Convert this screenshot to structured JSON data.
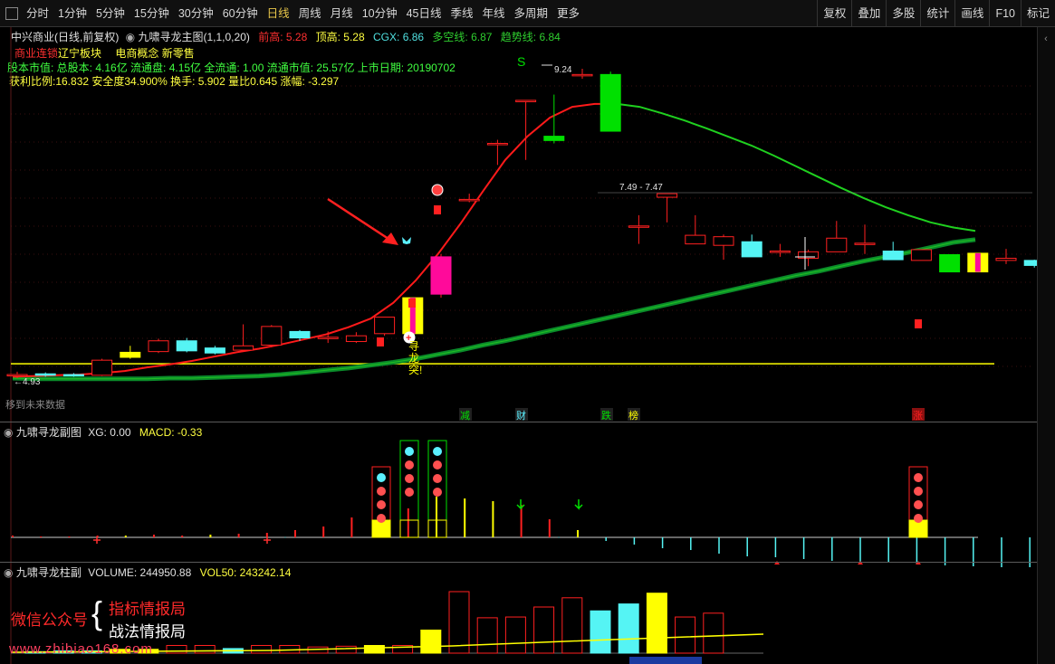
{
  "toolbar": {
    "periods": [
      "分时",
      "1分钟",
      "5分钟",
      "15分钟",
      "30分钟",
      "60分钟",
      "日线",
      "周线",
      "月线",
      "10分钟",
      "45日线",
      "季线",
      "年线",
      "多周期",
      "更多"
    ],
    "active_period": "日线",
    "right": [
      "复权",
      "叠加",
      "多股",
      "统计",
      "画线",
      "F10",
      "标记"
    ]
  },
  "main": {
    "stock": "中兴商业(日线,前复权)",
    "indicator": "九啸寻龙主图(1,1,0,20)",
    "qg_label": "前高:",
    "qg_val": "5.28",
    "dg_label": "顶高:",
    "dg_val": "5.28",
    "cgx_label": "CGX:",
    "cgx_val": "6.86",
    "dkx_label": "多空线:",
    "dkx_val": "6.87",
    "qsx_label": "趋势线:",
    "qsx_val": "6.84",
    "sector1": "商业连锁",
    "sector2": "辽宁板块",
    "concept": "电商概念 新零售",
    "fund_line": "股本市值: 总股本: 4.16亿 流通盘: 4.15亿 全流通: 1.00 流通市值: 25.57亿 上市日期: 20190702",
    "ratio_line": "获利比例:16.832   安全度34.900%      换手: 5.902   量比0.645    涨幅: -3.297",
    "price_high": "9.24",
    "price_range": "7.49 - 7.47",
    "price_low": "4.93",
    "future_label": "移到未来数据",
    "s_mark": "S",
    "signal_text": [
      "寻",
      "龙",
      "突!"
    ],
    "event_tags": [
      "减",
      "财",
      "跌",
      "榜",
      "涨"
    ]
  },
  "sub1": {
    "title": "九啸寻龙副图",
    "xg_label": "XG:",
    "xg_val": "0.00",
    "macd_label": "MACD:",
    "macd_val": "-0.33"
  },
  "sub2": {
    "title": "九啸寻龙柱副",
    "vol_label": "VOLUME:",
    "vol_val": "244950.88",
    "vol50_label": "VOL50:",
    "vol50_val": "243242.14"
  },
  "watermark": {
    "left": "微信公众号",
    "line1": "指标情报局",
    "line2": "战法情报局",
    "url": "www.zhibiao168.com"
  },
  "colors": {
    "up": "#ff2020",
    "down": "#55f4f4",
    "magenta": "#ff0a9a",
    "yellow": "#ffff00",
    "green": "#00e000",
    "ma_red": "#ff1a1a",
    "ma_green": "#1fd01f",
    "dark_green": "#0a8a2a"
  },
  "chart_data": {
    "type": "candlestick",
    "candles": [
      {
        "o": 4.98,
        "c": 4.98,
        "h": 5.02,
        "l": 4.93,
        "color": "up"
      },
      {
        "o": 4.99,
        "c": 4.97,
        "h": 5.01,
        "l": 4.95,
        "color": "down"
      },
      {
        "o": 4.98,
        "c": 4.97,
        "h": 5.0,
        "l": 4.95,
        "color": "down"
      },
      {
        "o": 4.97,
        "c": 5.18,
        "h": 5.2,
        "l": 4.96,
        "color": "up"
      },
      {
        "o": 5.22,
        "c": 5.29,
        "h": 5.38,
        "l": 5.2,
        "color": "yellow"
      },
      {
        "o": 5.3,
        "c": 5.45,
        "h": 5.48,
        "l": 5.28,
        "color": "up"
      },
      {
        "o": 5.45,
        "c": 5.31,
        "h": 5.49,
        "l": 5.29,
        "color": "down"
      },
      {
        "o": 5.35,
        "c": 5.28,
        "h": 5.38,
        "l": 5.26,
        "color": "down"
      },
      {
        "o": 5.32,
        "c": 5.38,
        "h": 5.68,
        "l": 5.3,
        "color": "up"
      },
      {
        "o": 5.39,
        "c": 5.65,
        "h": 5.67,
        "l": 5.36,
        "color": "up"
      },
      {
        "o": 5.58,
        "c": 5.49,
        "h": 5.6,
        "l": 5.45,
        "color": "down"
      },
      {
        "o": 5.48,
        "c": 5.5,
        "h": 5.58,
        "l": 5.42,
        "color": "up"
      },
      {
        "o": 5.44,
        "c": 5.52,
        "h": 5.57,
        "l": 5.42,
        "color": "up"
      },
      {
        "o": 5.55,
        "c": 5.78,
        "h": 5.78,
        "l": 5.52,
        "color": "up"
      },
      {
        "o": 5.55,
        "c": 6.05,
        "h": 6.05,
        "l": 5.5,
        "color": "yellow"
      },
      {
        "o": 6.1,
        "c": 6.62,
        "h": 6.66,
        "l": 6.05,
        "color": "magenta"
      },
      {
        "o": 7.42,
        "c": 7.42,
        "h": 7.5,
        "l": 7.38,
        "color": "up"
      },
      {
        "o": 8.2,
        "c": 8.2,
        "h": 8.25,
        "l": 7.9,
        "color": "up"
      },
      {
        "o": 8.8,
        "c": 8.8,
        "h": 8.8,
        "l": 7.97,
        "color": "up"
      },
      {
        "o": 8.3,
        "c": 8.24,
        "h": 8.88,
        "l": 8.2,
        "color": "green"
      },
      {
        "o": 9.16,
        "c": 9.16,
        "h": 9.24,
        "l": 9.1,
        "color": "up"
      },
      {
        "o": 9.16,
        "c": 8.37,
        "h": 9.2,
        "l": 8.37,
        "color": "green"
      },
      {
        "o": 7.05,
        "c": 7.05,
        "h": 7.2,
        "l": 6.8,
        "color": "up"
      },
      {
        "o": 7.5,
        "c": 7.45,
        "h": 7.49,
        "l": 7.1,
        "color": "up"
      },
      {
        "o": 6.8,
        "c": 6.92,
        "h": 7.2,
        "l": 6.8,
        "color": "up"
      },
      {
        "o": 6.78,
        "c": 6.9,
        "h": 6.93,
        "l": 6.58,
        "color": "up"
      },
      {
        "o": 6.83,
        "c": 6.62,
        "h": 6.93,
        "l": 6.62,
        "color": "down"
      },
      {
        "o": 6.69,
        "c": 6.7,
        "h": 6.8,
        "l": 6.62,
        "color": "up"
      },
      {
        "o": 6.6,
        "c": 6.69,
        "h": 6.72,
        "l": 6.49,
        "color": "up"
      },
      {
        "o": 6.69,
        "c": 6.88,
        "h": 7.12,
        "l": 6.69,
        "color": "up"
      },
      {
        "o": 6.81,
        "c": 6.81,
        "h": 7.07,
        "l": 6.66,
        "color": "up"
      },
      {
        "o": 6.7,
        "c": 6.58,
        "h": 6.83,
        "l": 6.58,
        "color": "down"
      },
      {
        "o": 6.57,
        "c": 6.72,
        "h": 6.72,
        "l": 6.57,
        "color": "up"
      },
      {
        "o": 6.65,
        "c": 6.41,
        "h": 6.65,
        "l": 6.41,
        "color": "green"
      },
      {
        "o": 6.41,
        "c": 6.67,
        "h": 6.67,
        "l": 6.41,
        "color": "yellow"
      },
      {
        "o": 6.57,
        "c": 6.6,
        "h": 6.73,
        "l": 6.52,
        "color": "up"
      },
      {
        "o": 6.57,
        "c": 6.5,
        "h": 6.58,
        "l": 6.47,
        "color": "down"
      }
    ],
    "ma_red": [
      4.95,
      4.96,
      4.97,
      4.98,
      5.0,
      5.03,
      5.08,
      5.12,
      5.17,
      5.23,
      5.29,
      5.34,
      5.4,
      5.47,
      5.54,
      5.64,
      5.76,
      5.98,
      6.29,
      6.66,
      7.08,
      7.53,
      7.97,
      8.3,
      8.56,
      8.71,
      8.75,
      8.75,
      8.71,
      8.62,
      8.52,
      8.41,
      8.29,
      8.17,
      8.03,
      7.88,
      7.73,
      7.58,
      7.44,
      7.31,
      7.2,
      7.1,
      7.03,
      6.98
    ],
    "ma_green": [
      4.93,
      4.92,
      4.92,
      4.92,
      4.92,
      4.92,
      4.92,
      4.93,
      4.93,
      4.94,
      4.95,
      4.96,
      4.98,
      5.01,
      5.04,
      5.07,
      5.11,
      5.15,
      5.2,
      5.26,
      5.32,
      5.39,
      5.45,
      5.52,
      5.59,
      5.66,
      5.73,
      5.8,
      5.87,
      5.94,
      6.01,
      6.08,
      6.15,
      6.22,
      6.29,
      6.36,
      6.42,
      6.49,
      6.56,
      6.62,
      6.68,
      6.75,
      6.82,
      6.86
    ],
    "flat_line": 5.13,
    "volume": [
      0.02,
      0.03,
      0.03,
      0.05,
      0.05,
      0.1,
      0.1,
      0.06,
      0.1,
      0.1,
      0.08,
      0.09,
      0.1,
      0.1,
      0.3,
      0.8,
      0.46,
      0.47,
      0.6,
      0.72,
      0.55,
      0.64,
      0.78,
      0.47,
      0.52
    ],
    "volume_colors": [
      "down",
      "down",
      "down",
      "yellow",
      "yellow",
      "up",
      "up",
      "down",
      "up",
      "up",
      "up",
      "up",
      "yellow",
      "up",
      "yellow",
      "up",
      "up",
      "up",
      "up",
      "up",
      "down",
      "down",
      "yellow",
      "up",
      "up"
    ],
    "macd_bars": [
      0.02,
      0.01,
      0.01,
      0.02,
      0.02,
      0.03,
      0.02,
      0.03,
      0.04,
      0.05,
      0.08,
      0.12,
      0.22,
      0.25,
      0.32,
      0.45,
      0.43,
      0.4,
      0.36,
      0.2,
      0.08,
      -0.04,
      -0.08,
      -0.12,
      -0.14,
      -0.18,
      -0.21,
      -0.22,
      -0.24,
      -0.26,
      -0.27,
      -0.28,
      -0.29,
      -0.31,
      -0.32,
      -0.33,
      -0.33
    ],
    "macd_colors": [
      "up",
      "up",
      "up",
      "up",
      "yellow",
      "up",
      "up",
      "yellow",
      "up",
      "up",
      "up",
      "up",
      "up",
      "up",
      "up",
      "yellow",
      "yellow",
      "yellow",
      "up",
      "up",
      "yellow",
      "yellow",
      "up",
      "up",
      "down",
      "down",
      "down",
      "down",
      "down",
      "down",
      "down",
      "down",
      "down",
      "down",
      "down",
      "down",
      "down"
    ]
  }
}
